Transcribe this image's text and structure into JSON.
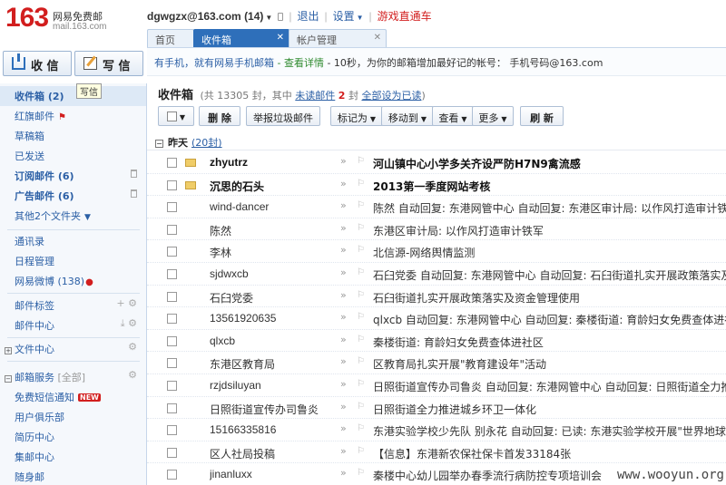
{
  "logo": {
    "number": "163",
    "name": "网易免费邮",
    "domain": "mail.163.com"
  },
  "topbar": {
    "account": "dgwgzx@163.com (14)",
    "logout": "退出",
    "settings": "设置",
    "game": "游戏直通车"
  },
  "tabs": [
    {
      "label": "首页"
    },
    {
      "label": "收件箱"
    },
    {
      "label": "帐户管理"
    }
  ],
  "notice": {
    "part1": "有手机，就有网易手机邮箱",
    "link": "查看详情",
    "part2": "- 10秒，为你的邮箱增加最好记的帐号：  手机号码@163.com"
  },
  "actions": {
    "receive": "收 信",
    "write": "写 信",
    "tooltip": "写信"
  },
  "sidebar": {
    "inbox": "收件箱 (2)",
    "redflag": "红旗邮件",
    "drafts": "草稿箱",
    "sent": "已发送",
    "subscription": "订阅邮件 (6)",
    "ads": "广告邮件 (6)",
    "other_folders": "其他2个文件夹",
    "contacts": "通讯录",
    "calendar": "日程管理",
    "weibo": "网易微博 (138)",
    "mail_tags": "邮件标签",
    "mail_center": "邮件中心",
    "file_center": "文件中心",
    "mail_services": "邮箱服务",
    "mail_services_all": "[全部]",
    "sms_notify": "免费短信通知",
    "new_badge": "NEW",
    "user_club": "用户俱乐部",
    "resume_center": "简历中心",
    "stamp_center": "集邮中心",
    "suishenyou": "随身邮"
  },
  "main": {
    "title": "收件箱",
    "total_pre": "(共 13305 封，其中",
    "unread_link": "未读邮件",
    "unread_count": "2",
    "unread_suffix": "封",
    "mark_read": "全部设为已读",
    "close_paren": ")"
  },
  "toolbar": {
    "delete": "删 除",
    "report_spam": "举报垃圾邮件",
    "mark_as": "标记为",
    "move_to": "移动到",
    "view": "查看",
    "more": "更多",
    "refresh": "刷 新"
  },
  "group": {
    "label": "昨天",
    "count": "(20封)"
  },
  "emails": [
    {
      "sender": "zhyutrz",
      "subject": "河山镇中心小学多关齐设严防H7N9禽流感",
      "unread": true
    },
    {
      "sender": "沉思的石头",
      "subject": "2013第一季度网站考核",
      "unread": true
    },
    {
      "sender": "wind-dancer",
      "subject": "陈然 自动回复: 东港网管中心 自动回复: 东港区审计局: 以作风打造审计铁军",
      "unread": false
    },
    {
      "sender": "陈然",
      "subject": "东港区审计局: 以作风打造审计铁军",
      "unread": false
    },
    {
      "sender": "李林",
      "subject": "北信源-网络舆情监测",
      "unread": false
    },
    {
      "sender": "sjdwxcb",
      "subject": "石臼党委 自动回复: 东港网管中心 自动回复: 石臼街道扎实开展政策落实及资金管理使用",
      "unread": false
    },
    {
      "sender": "石臼党委",
      "subject": "石臼街道扎实开展政策落实及资金管理使用",
      "unread": false
    },
    {
      "sender": "13561920635",
      "subject": "qlxcb 自动回复: 东港网管中心 自动回复: 秦楼街道: 育龄妇女免费查体进社区",
      "unread": false
    },
    {
      "sender": "qlxcb",
      "subject": "秦楼街道: 育龄妇女免费查体进社区",
      "unread": false
    },
    {
      "sender": "东港区教育局",
      "subject": "区教育局扎实开展\"教育建设年\"活动",
      "unread": false
    },
    {
      "sender": "rzjdsiluyan",
      "subject": "日照街道宣传办司鲁炎 自动回复: 东港网管中心 自动回复: 日照街道全力推进城乡环卫一体化",
      "unread": false
    },
    {
      "sender": "日照街道宣传办司鲁炎",
      "subject": "日照街道全力推进城乡环卫一体化",
      "unread": false
    },
    {
      "sender": "15166335816",
      "subject": "东港实验学校少先队  别永花 自动回复: 已读: 东港实验学校开展\"世界地球日\"主题活动",
      "unread": false
    },
    {
      "sender": "区人社局投稿",
      "subject": "【信息】东港新农保社保卡首发33184张",
      "unread": false
    },
    {
      "sender": "jinanluxx",
      "subject": "秦楼中心幼儿园举办春季流行病防控专项培训会",
      "unread": false
    }
  ],
  "watermark": "www.wooyun.org"
}
